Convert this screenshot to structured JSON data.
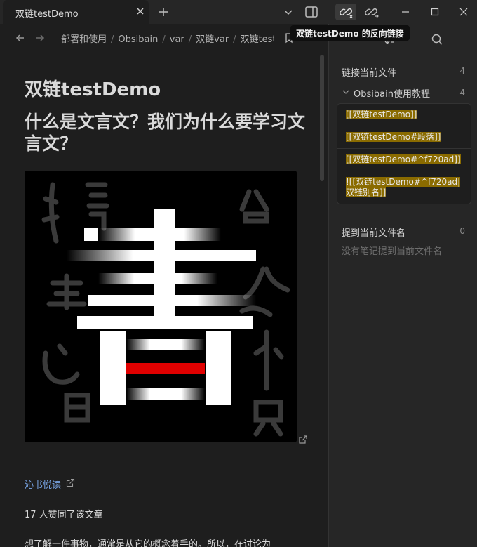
{
  "tab": {
    "title": "双链testDemo"
  },
  "tooltip": "双链testDemo 的反向链接",
  "breadcrumb": [
    "部署和使用",
    "Obsibain",
    "var",
    "双链var",
    "双链testDemo"
  ],
  "content": {
    "h1": "双链testDemo",
    "h2": "什么是文言文？我们为什么要学习文言文？",
    "link": "沁书悦读",
    "p1": "17 人赞同了该文章",
    "p2": "想了解一件事物，通常是从它的概念着手的。所以，在讨论为"
  },
  "backlinks": {
    "linked_title": "链接当前文件",
    "linked_count": "4",
    "file_name": "Obsibain使用教程",
    "file_count": "4",
    "results": [
      "[[双链testDemo]]",
      "[[双链testDemo#段落]]",
      "[[双链testDemo#^f720ad]]",
      "![[双链testDemo#^f720ad|双链别名]]"
    ],
    "unlinked_title": "提到当前文件名",
    "unlinked_count": "0",
    "unlinked_empty": "没有笔记提到当前文件名"
  },
  "colors": {
    "accent_link": "#7aa7e8",
    "highlight": "#8a6b00",
    "logo_red": "#e00000"
  }
}
